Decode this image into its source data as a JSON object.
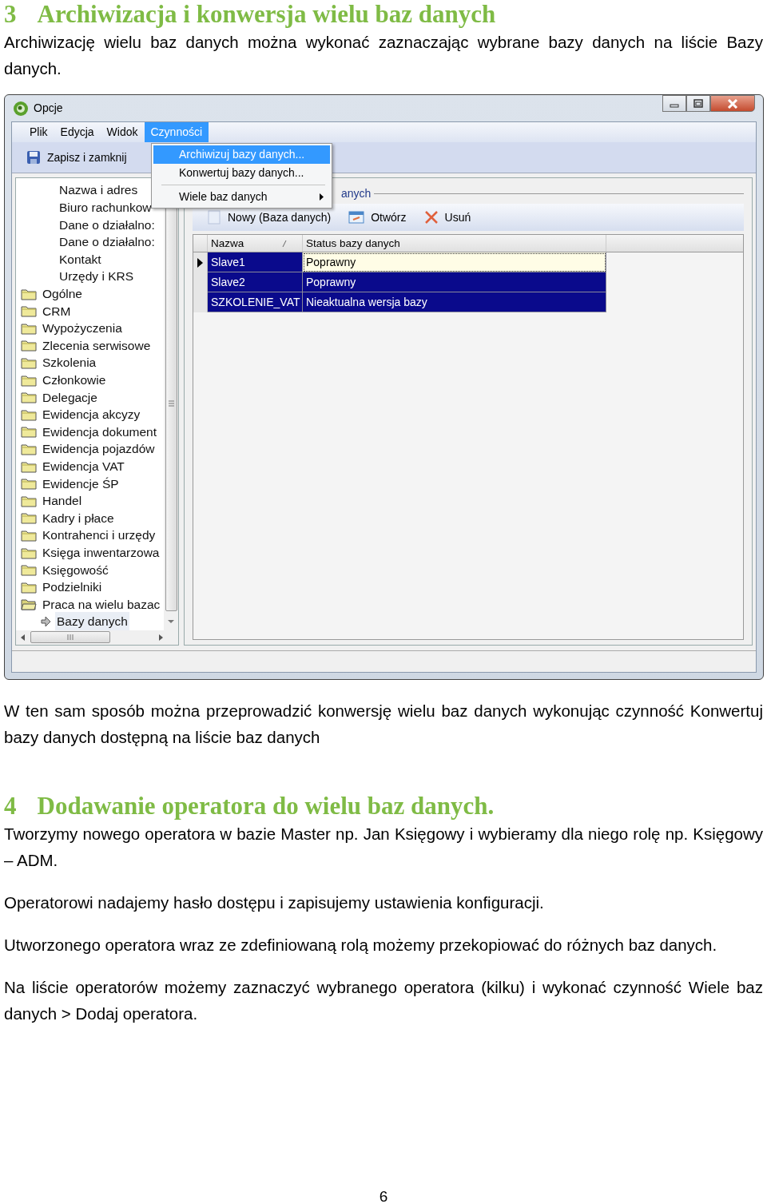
{
  "heading_1": {
    "number": "3",
    "title": "Archiwizacja i konwersja wielu baz danych"
  },
  "paragraph_1": "Archiwizację wielu baz danych można wykonać zaznaczając wybrane bazy danych na liście Bazy danych.",
  "window": {
    "title": "Opcje",
    "menu_bar": [
      {
        "label": "Plik",
        "selected": false
      },
      {
        "label": "Edycja",
        "selected": false
      },
      {
        "label": "Widok",
        "selected": false
      },
      {
        "label": "Czynności",
        "selected": true
      }
    ],
    "menu": [
      {
        "kind": "item",
        "label": "Archiwizuj bazy danych...",
        "selected": true
      },
      {
        "kind": "item",
        "label": "Konwertuj bazy danych...",
        "selected": false
      },
      {
        "kind": "separator"
      },
      {
        "kind": "submenu",
        "label": "Wiele baz danych",
        "selected": false
      }
    ],
    "save_button": "Zapisz i zamknij",
    "tree": [
      {
        "kind": "leaf",
        "label": "Nazwa i adres",
        "selected": false
      },
      {
        "kind": "leaf",
        "label": "Biuro rachunkow",
        "selected": false
      },
      {
        "kind": "leaf",
        "label": "Dane o działalno:",
        "selected": false
      },
      {
        "kind": "leaf",
        "label": "Dane o działalno:",
        "selected": false
      },
      {
        "kind": "leaf",
        "label": "Kontakt",
        "selected": false
      },
      {
        "kind": "leaf",
        "label": "Urzędy i KRS",
        "selected": false
      },
      {
        "kind": "folder",
        "label": "Ogólne",
        "selected": false,
        "expanded": false
      },
      {
        "kind": "folder",
        "label": "CRM",
        "selected": false,
        "expanded": false
      },
      {
        "kind": "folder",
        "label": "Wypożyczenia",
        "selected": false,
        "expanded": false
      },
      {
        "kind": "folder",
        "label": "Zlecenia serwisowe",
        "selected": false,
        "expanded": false
      },
      {
        "kind": "folder",
        "label": "Szkolenia",
        "selected": false,
        "expanded": false
      },
      {
        "kind": "folder",
        "label": "Członkowie",
        "selected": false,
        "expanded": false
      },
      {
        "kind": "folder",
        "label": "Delegacje",
        "selected": false,
        "expanded": false
      },
      {
        "kind": "folder",
        "label": "Ewidencja akcyzy",
        "selected": false,
        "expanded": false
      },
      {
        "kind": "folder",
        "label": "Ewidencja dokument",
        "selected": false,
        "expanded": false
      },
      {
        "kind": "folder",
        "label": "Ewidencja pojazdów",
        "selected": false,
        "expanded": false
      },
      {
        "kind": "folder",
        "label": "Ewidencja VAT",
        "selected": false,
        "expanded": false
      },
      {
        "kind": "folder",
        "label": "Ewidencje ŚP",
        "selected": false,
        "expanded": false
      },
      {
        "kind": "folder",
        "label": "Handel",
        "selected": false,
        "expanded": false
      },
      {
        "kind": "folder",
        "label": "Kadry i płace",
        "selected": false,
        "expanded": false
      },
      {
        "kind": "folder",
        "label": "Kontrahenci i urzędy",
        "selected": false,
        "expanded": false
      },
      {
        "kind": "folder",
        "label": "Księga inwentarzowa",
        "selected": false,
        "expanded": false
      },
      {
        "kind": "folder",
        "label": "Księgowość",
        "selected": false,
        "expanded": false
      },
      {
        "kind": "folder",
        "label": "Podzielniki",
        "selected": false,
        "expanded": false
      },
      {
        "kind": "folder",
        "label": "Praca na wielu bazac",
        "selected": false,
        "expanded": true,
        "children": [
          {
            "kind": "shortcut",
            "label": "Bazy danych",
            "selected": true
          }
        ]
      }
    ],
    "group_caption": "anych",
    "panel_toolbar": [
      {
        "kind": "new",
        "label": "Nowy (Baza danych)"
      },
      {
        "kind": "open",
        "label": "Otwórz"
      },
      {
        "kind": "delete",
        "label": "Usuń"
      }
    ],
    "grid": {
      "columns": [
        "Nazwa",
        "Status bazy danych"
      ],
      "rows": [
        {
          "cells": [
            "Slave1",
            "Poprawny"
          ],
          "selected": true,
          "current": true
        },
        {
          "cells": [
            "Slave2",
            "Poprawny"
          ],
          "selected": true,
          "current": false
        },
        {
          "cells": [
            "SZKOLENIE_VAT",
            "Nieaktualna wersja bazy"
          ],
          "selected": true,
          "current": false
        }
      ]
    }
  },
  "paragraph_2": "W ten sam sposób można przeprowadzić konwersję wielu baz danych wykonując czynność Konwertuj bazy danych dostępną na liście baz danych",
  "heading_2": {
    "number": "4",
    "title": "Dodawanie operatora do wielu baz danych."
  },
  "paragraphs": [
    "Tworzymy nowego operatora w bazie Master np. Jan Księgowy  i wybieramy dla niego rolę np. Księgowy – ADM.",
    "Operatorowi nadajemy hasło dostępu i zapisujemy ustawienia konfiguracji.",
    "Utworzonego operatora wraz ze zdefiniowaną rolą możemy przekopiować do różnych baz danych.",
    "Na liście operatorów możemy zaznaczyć wybranego operatora (kilku) i wykonać czynność Wiele baz danych > Dodaj operatora."
  ],
  "page_number": "6"
}
